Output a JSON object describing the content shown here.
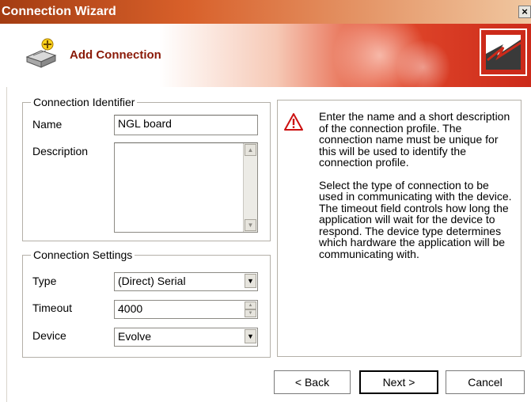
{
  "window": {
    "title": "Connection Wizard",
    "close_glyph": "×"
  },
  "header": {
    "title": "Add Connection",
    "icon": "add-connection-icon",
    "logo": "brand-logo"
  },
  "identifier": {
    "legend": "Connection Identifier",
    "name_label": "Name",
    "name_value": "NGL board",
    "description_label": "Description",
    "description_value": ""
  },
  "settings": {
    "legend": "Connection Settings",
    "type_label": "Type",
    "type_value": "(Direct) Serial",
    "timeout_label": "Timeout",
    "timeout_value": "4000",
    "device_label": "Device",
    "device_value": "Evolve"
  },
  "info": {
    "icon": "warning-icon",
    "paragraph1": "Enter the name and a short description of the connection profile. The connection name must be unique for this will be used to identify the connection profile.",
    "paragraph2": "Select the type of connection to be used in communicating with the device. The timeout field controls how long the application will wait for the device to respond. The device type determines which hardware the application will be communicating with."
  },
  "buttons": {
    "back": "< Back",
    "next": "Next >",
    "cancel": "Cancel"
  },
  "colors": {
    "title_accent": "#a33c12",
    "header_red": "#cc2a1a",
    "warning_red": "#cc1111"
  }
}
